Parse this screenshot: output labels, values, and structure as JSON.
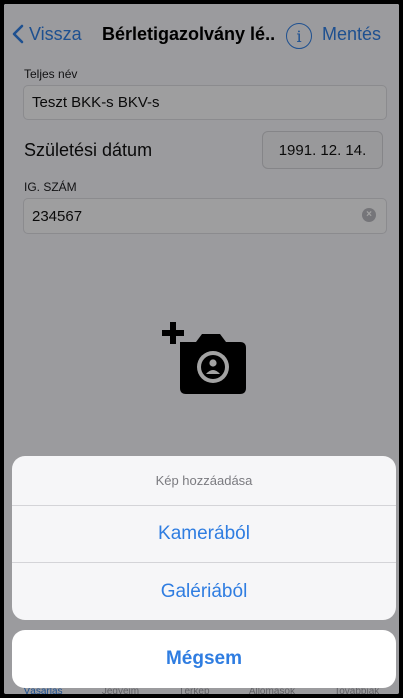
{
  "nav": {
    "back_label": "Vissza",
    "title": "Bérletigazolvány lé...",
    "info_label": "i",
    "save_label": "Mentés"
  },
  "form": {
    "full_name_label": "Teljes név",
    "full_name_value": "Teszt BKK-s BKV-s",
    "dob_label": "Születési dátum",
    "dob_value": "1991. 12. 14.",
    "id_label": "IG. SZÁM",
    "id_value": "234567"
  },
  "photo": {
    "icon": "add-photo-camera-icon"
  },
  "action_sheet": {
    "title": "Kép hozzáadása",
    "actions": [
      "Kamerából",
      "Galériából"
    ],
    "cancel_label": "Mégsem"
  },
  "tabbar": {
    "items": [
      "Vásárlás",
      "Jegyeim",
      "Térkép",
      "Állomások",
      "Továbbiak"
    ]
  },
  "colors": {
    "accent": "#2f7de1"
  }
}
